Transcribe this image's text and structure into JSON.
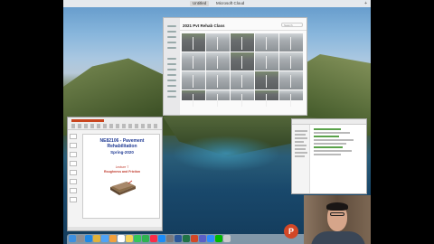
{
  "menubar": {
    "tabs": [
      {
        "label": "Untitled",
        "active": true
      },
      {
        "label": "Microsoft Cloud",
        "active": false
      }
    ],
    "add_tab_icon": "+"
  },
  "photos_window": {
    "title": "2021 Pvt Rehab Class",
    "search_placeholder": "Search"
  },
  "powerpoint": {
    "slide_title_line1": "NE82106 - Pavement Rehabilitation",
    "slide_title_line2": "Spring-2020",
    "lecture": "Lecture 7",
    "topic": "Roughness and Friction",
    "app_icon": "P"
  },
  "colors": {
    "slide_title": "#1f3a93",
    "slide_accent": "#c0392b",
    "powerpoint_brand": "#d24726"
  },
  "icons": [
    "finder-icon",
    "launchpad-icon",
    "safari-icon",
    "chrome-icon",
    "mail-icon",
    "photos-icon",
    "calendar-icon",
    "notes-icon",
    "messages-icon",
    "facetime-icon",
    "music-icon",
    "app-store-icon",
    "settings-icon",
    "word-icon",
    "excel-icon",
    "powerpoint-icon",
    "teams-icon",
    "zoom-icon",
    "line-icon",
    "trash-icon"
  ]
}
